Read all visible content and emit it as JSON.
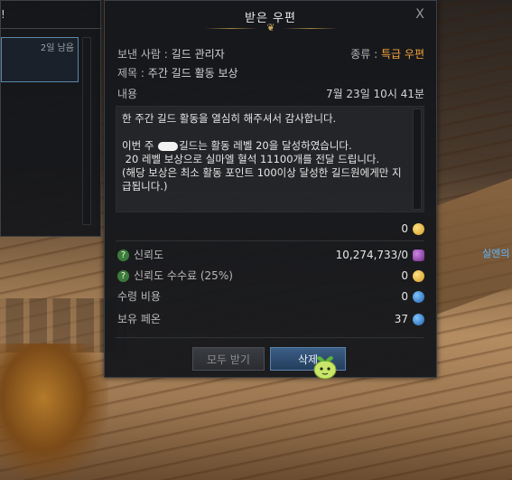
{
  "background_window": {
    "title_fragment": "!",
    "list_item_days": "2일 남음"
  },
  "mail": {
    "title": "받은 우편",
    "close_label": "X",
    "sender_label": "보낸 사람 :",
    "sender_value": "길드 관리자",
    "kind_label": "종류 :",
    "kind_value": "특급 우편",
    "subject_label": "제목 :",
    "subject_value": "주간 길드 활동 보상",
    "content_label": "내용",
    "date": "7월 23일 10시 41분",
    "body_line1": "한 주간 길드 활동을 열심히 해주셔서 감사합니다.",
    "body_line2_pre": "이번 주 ",
    "body_line2_post": "길드는 활동 레벨 20을 달성하였습니다.",
    "body_line3": " 20 레벨 보상으로 실마엘 혈석 11100개를 전달 드립니다.",
    "body_line4": "(해당 보상은 최소 활동 포인트 100이상 달성한 길드원에게만 지",
    "body_line5": "급됩니다.)",
    "gold_amount": "0",
    "trust_label": "신뢰도",
    "trust_value": "10,274,733/0",
    "trust_fee_label": "신뢰도 수수료 (25%)",
    "trust_fee_value": "0",
    "receive_cost_label": "수령 비용",
    "receive_cost_value": "0",
    "held_pheon_label": "보유 페온",
    "held_pheon_value": "37",
    "receive_all_label": "모두 받기",
    "delete_label": "삭제"
  },
  "scene": {
    "npc_name": "실엔의"
  }
}
